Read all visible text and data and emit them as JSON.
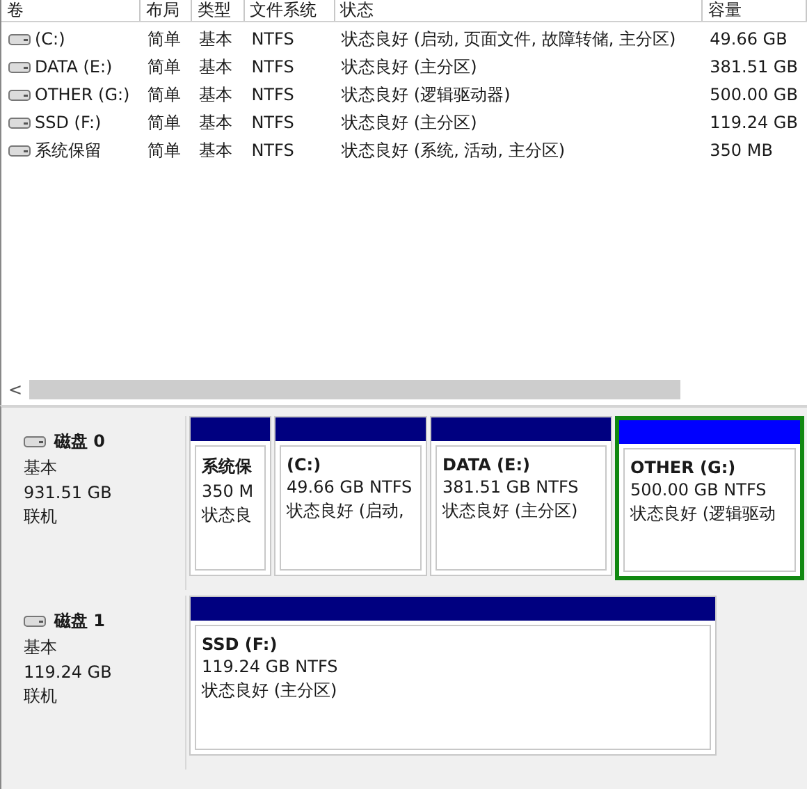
{
  "volume_table": {
    "columns": [
      "卷",
      "布局",
      "类型",
      "文件系统",
      "状态",
      "容量"
    ],
    "rows": [
      {
        "cells": [
          "(C:)",
          "简单",
          "基本",
          "NTFS",
          "状态良好 (启动, 页面文件, 故障转储, 主分区)",
          "49.66 GB"
        ]
      },
      {
        "cells": [
          "DATA (E:)",
          "简单",
          "基本",
          "NTFS",
          "状态良好 (主分区)",
          "381.51 GB"
        ]
      },
      {
        "cells": [
          "OTHER (G:)",
          "简单",
          "基本",
          "NTFS",
          "状态良好 (逻辑驱动器)",
          "500.00 GB"
        ]
      },
      {
        "cells": [
          "SSD (F:)",
          "简单",
          "基本",
          "NTFS",
          "状态良好 (主分区)",
          "119.24 GB"
        ]
      },
      {
        "cells": [
          "系统保留",
          "简单",
          "基本",
          "NTFS",
          "状态良好 (系统, 活动, 主分区)",
          "350 MB"
        ]
      }
    ]
  },
  "scrollbar": {
    "arrow": "<"
  },
  "disks": [
    {
      "name": "磁盘 0",
      "type": "基本",
      "size": "931.51 GB",
      "status": "联机",
      "partitions": [
        {
          "name": "系统保",
          "size": "350 M",
          "status": "状态良",
          "kind": "primary",
          "selected": false
        },
        {
          "name": "(C:)",
          "size": "49.66 GB NTFS",
          "status": "状态良好 (启动,",
          "kind": "primary",
          "selected": false
        },
        {
          "name": "DATA  (E:)",
          "size": "381.51 GB NTFS",
          "status": "状态良好 (主分区)",
          "kind": "primary",
          "selected": false
        },
        {
          "name": "OTHER  (G:)",
          "size": "500.00 GB NTFS",
          "status": "状态良好 (逻辑驱动",
          "kind": "logical",
          "selected": true
        }
      ]
    },
    {
      "name": "磁盘 1",
      "type": "基本",
      "size": "119.24 GB",
      "status": "联机",
      "partitions": [
        {
          "name": "SSD  (F:)",
          "size": "119.24 GB NTFS",
          "status": "状态良好 (主分区)",
          "kind": "primary",
          "selected": false
        }
      ]
    }
  ]
}
